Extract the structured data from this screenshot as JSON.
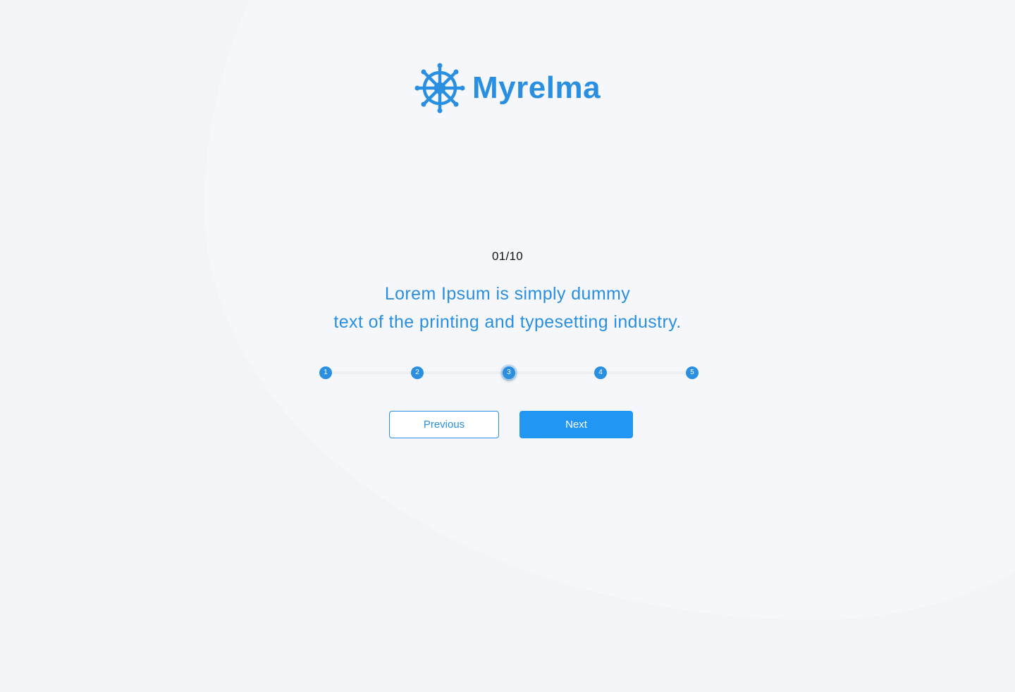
{
  "brand": {
    "name": "Myrelma",
    "icon": "ship-wheel-icon",
    "color": "#2a8fe0"
  },
  "progress": {
    "counter": "01/10"
  },
  "headline": {
    "line1": "Lorem Ipsum is simply dummy",
    "line2": "text of the printing and typesetting industry."
  },
  "stepper": {
    "steps": [
      {
        "label": "1"
      },
      {
        "label": "2"
      },
      {
        "label": "3",
        "active": true
      },
      {
        "label": "4"
      },
      {
        "label": "5"
      }
    ]
  },
  "actions": {
    "previous_label": "Previous",
    "next_label": "Next"
  },
  "colors": {
    "accent": "#2196f3",
    "background": "#f2f4f7"
  }
}
